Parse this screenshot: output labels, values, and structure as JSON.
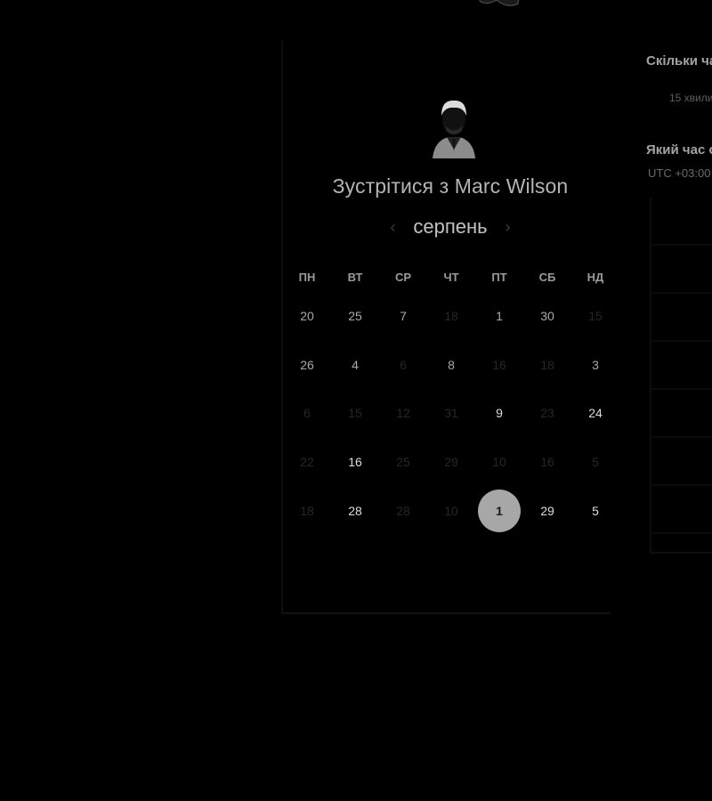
{
  "booking": {
    "title": "Зустрітися з Marc Wilson",
    "month": "серпень",
    "weekdays": [
      "ПН",
      "ВТ",
      "СР",
      "ЧТ",
      "ПТ",
      "СБ",
      "НД"
    ],
    "weeks": [
      [
        {
          "d": "20",
          "s": "avail"
        },
        {
          "d": "25",
          "s": "avail"
        },
        {
          "d": "7",
          "s": "avail"
        },
        {
          "d": "18",
          "s": "faded"
        },
        {
          "d": "1",
          "s": "avail"
        },
        {
          "d": "30",
          "s": "avail"
        },
        {
          "d": "15",
          "s": "faded"
        }
      ],
      [
        {
          "d": "26",
          "s": "avail"
        },
        {
          "d": "4",
          "s": "avail"
        },
        {
          "d": "6",
          "s": "faded"
        },
        {
          "d": "8",
          "s": "avail"
        },
        {
          "d": "16",
          "s": "faded"
        },
        {
          "d": "18",
          "s": "faded"
        },
        {
          "d": "3",
          "s": "avail"
        }
      ],
      [
        {
          "d": "6",
          "s": "faded"
        },
        {
          "d": "15",
          "s": "faded"
        },
        {
          "d": "12",
          "s": "faded"
        },
        {
          "d": "31",
          "s": "faded"
        },
        {
          "d": "9",
          "s": "bright"
        },
        {
          "d": "23",
          "s": "faded"
        },
        {
          "d": "24",
          "s": "bright"
        }
      ],
      [
        {
          "d": "22",
          "s": "faded"
        },
        {
          "d": "16",
          "s": "bright"
        },
        {
          "d": "25",
          "s": "faded"
        },
        {
          "d": "29",
          "s": "faded"
        },
        {
          "d": "10",
          "s": "faded"
        },
        {
          "d": "16",
          "s": "faded"
        },
        {
          "d": "5",
          "s": "faded"
        }
      ],
      [
        {
          "d": "18",
          "s": "faded"
        },
        {
          "d": "28",
          "s": "bright"
        },
        {
          "d": "28",
          "s": "faded"
        },
        {
          "d": "10",
          "s": "faded"
        },
        {
          "d": "1",
          "s": "selected"
        },
        {
          "d": "29",
          "s": "bright"
        },
        {
          "d": "5",
          "s": "bright"
        }
      ]
    ]
  },
  "side": {
    "q_duration": "Скільки ча",
    "duration_value": "15 хвили",
    "q_time": "Який час с",
    "timezone": "UTC +03:00"
  }
}
